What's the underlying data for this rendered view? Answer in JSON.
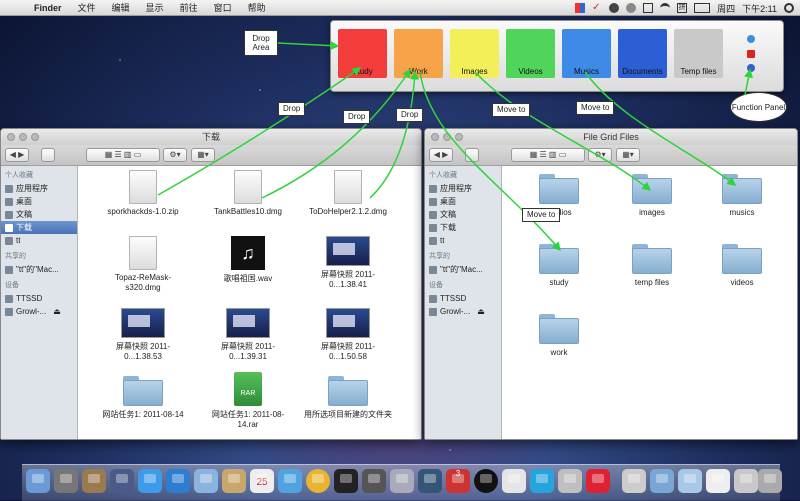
{
  "menubar": {
    "apple_glyph": "",
    "items": [
      "Finder",
      "文件",
      "编辑",
      "显示",
      "前往",
      "窗口",
      "帮助"
    ],
    "day": "周四",
    "time": "下午2:11"
  },
  "panel": {
    "tiles": [
      {
        "label": "Study",
        "color": "#f43c3c"
      },
      {
        "label": "Work",
        "color": "#f7a349"
      },
      {
        "label": "Images",
        "color": "#f3ef5a"
      },
      {
        "label": "Videos",
        "color": "#4fd65a"
      },
      {
        "label": "Musics",
        "color": "#3d8be6"
      },
      {
        "label": "Documents",
        "color": "#2c5fd6"
      },
      {
        "label": "Temp files",
        "color": "#c9c9c9"
      }
    ],
    "drop_area_label": "Drop Area",
    "function_panel_label": "Function Panel"
  },
  "annotations": {
    "drop_1": "Drop",
    "drop_2": "Drop",
    "drop_3": "Drop",
    "move_to_1": "Move to",
    "move_to_2": "Move to",
    "move_to_3": "Move to"
  },
  "left_window": {
    "title": "下载",
    "sidebar": {
      "favorites_heading": "个人收藏",
      "favorites": [
        "应用程序",
        "桌面",
        "文稿",
        "下载",
        "tt"
      ],
      "shared_heading": "共享的",
      "shared": [
        "\"tt\"的\"Mac..."
      ],
      "devices_heading": "设备",
      "devices": [
        "TTSSD",
        "Growl-..."
      ]
    },
    "items": [
      "sporkhackds-1.0.zip",
      "TankBattles10.dmg",
      "ToDoHelper2.1.2.dmg",
      "Topaz-ReMask-s320.dmg",
      "歌唱祖国.wav",
      "屏幕快照 2011-0...1.38.41",
      "屏幕快照 2011-0...1.38.53",
      "屏幕快照 2011-0...1.39.31",
      "屏幕快照 2011-0...1.50.58",
      "网站任务1: 2011-08-14",
      "网站任务1: 2011-08-14.rar",
      "用所选项目新建的文件夹"
    ]
  },
  "right_window": {
    "title": "File Grid Files",
    "sidebar": {
      "favorites_heading": "个人收藏",
      "favorites": [
        "应用程序",
        "桌面",
        "文稿",
        "下载",
        "tt"
      ],
      "shared_heading": "共享的",
      "shared": [
        "\"tt\"的\"Mac..."
      ],
      "devices_heading": "设备",
      "devices": [
        "TTSSD",
        "Growl-..."
      ]
    },
    "folders": [
      "studios",
      "images",
      "musics",
      "study",
      "temp files",
      "videos",
      "work"
    ]
  },
  "dock": {
    "badge": "3",
    "calendar_day": "25"
  }
}
